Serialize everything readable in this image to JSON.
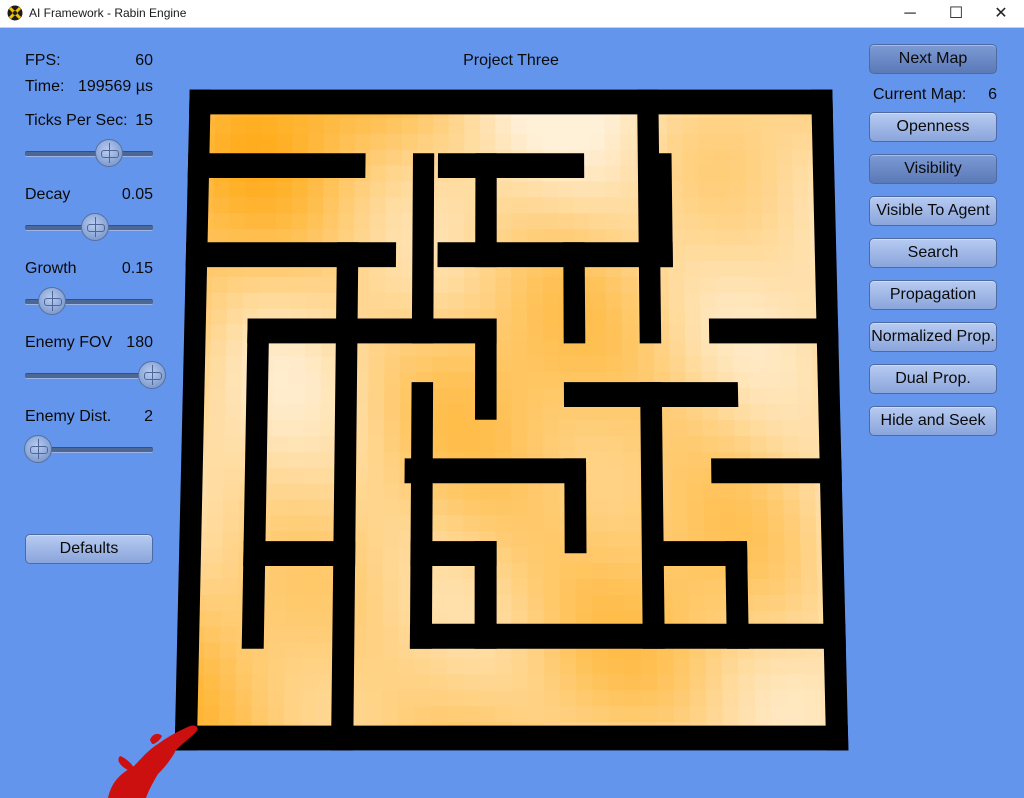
{
  "window": {
    "title": "AI Framework - Rabin Engine",
    "minimize_glyph": "─",
    "maximize_glyph": "☐",
    "close_glyph": "✕"
  },
  "stats": {
    "fps_label": "FPS:",
    "fps_value": "60",
    "time_label": "Time:",
    "time_value": "199569 µs"
  },
  "sliders": [
    {
      "label": "Ticks Per Sec:",
      "value": "15",
      "level": 0.62
    },
    {
      "label": "Decay",
      "value": "0.05",
      "level": 0.5
    },
    {
      "label": "Growth",
      "value": "0.15",
      "level": 0.12
    },
    {
      "label": "Enemy FOV",
      "value": "180",
      "level": 1.0
    },
    {
      "label": "Enemy Dist.",
      "value": "2",
      "level": 0.0
    }
  ],
  "defaults_button": "Defaults",
  "project_title": "Project Three",
  "right_panel": {
    "next_map": "Next Map",
    "current_map_label": "Current Map:",
    "current_map_value": "6",
    "buttons": [
      {
        "label": "Openness",
        "active": false
      },
      {
        "label": "Visibility",
        "active": true
      },
      {
        "label": "Visible To Agent",
        "active": false
      },
      {
        "label": "Search",
        "active": false
      },
      {
        "label": "Propagation",
        "active": false
      },
      {
        "label": "Normalized Prop.",
        "active": false
      },
      {
        "label": "Dual Prop.",
        "active": false
      },
      {
        "label": "Hide and Seek",
        "active": false
      }
    ]
  },
  "colors": {
    "background": "#6495ED",
    "wall": "#000000",
    "floor_light": "#FFF0D8",
    "floor_dark": "#FFAD1E",
    "agent": "#CC1010"
  }
}
